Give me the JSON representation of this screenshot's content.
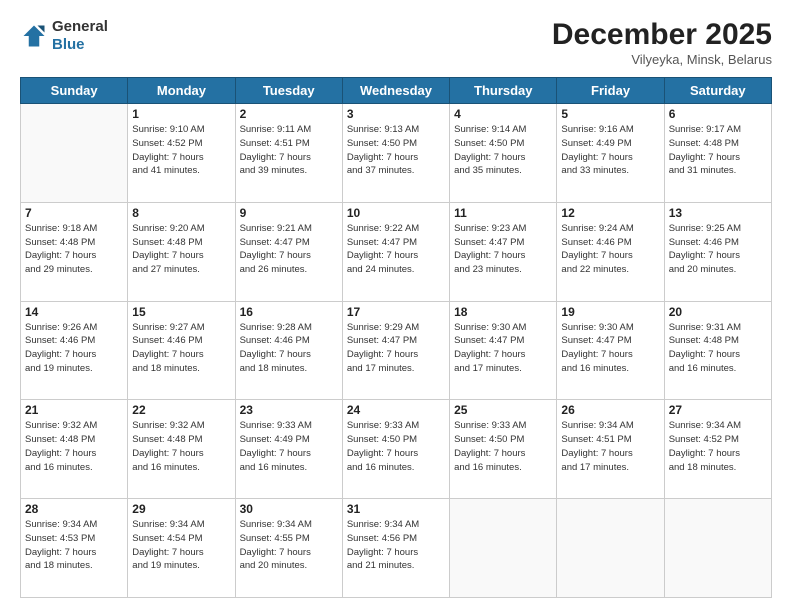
{
  "header": {
    "logo_line1": "General",
    "logo_line2": "Blue",
    "month": "December 2025",
    "location": "Vilyeyka, Minsk, Belarus"
  },
  "days_of_week": [
    "Sunday",
    "Monday",
    "Tuesday",
    "Wednesday",
    "Thursday",
    "Friday",
    "Saturday"
  ],
  "weeks": [
    [
      {
        "day": "",
        "info": ""
      },
      {
        "day": "1",
        "info": "Sunrise: 9:10 AM\nSunset: 4:52 PM\nDaylight: 7 hours\nand 41 minutes."
      },
      {
        "day": "2",
        "info": "Sunrise: 9:11 AM\nSunset: 4:51 PM\nDaylight: 7 hours\nand 39 minutes."
      },
      {
        "day": "3",
        "info": "Sunrise: 9:13 AM\nSunset: 4:50 PM\nDaylight: 7 hours\nand 37 minutes."
      },
      {
        "day": "4",
        "info": "Sunrise: 9:14 AM\nSunset: 4:50 PM\nDaylight: 7 hours\nand 35 minutes."
      },
      {
        "day": "5",
        "info": "Sunrise: 9:16 AM\nSunset: 4:49 PM\nDaylight: 7 hours\nand 33 minutes."
      },
      {
        "day": "6",
        "info": "Sunrise: 9:17 AM\nSunset: 4:48 PM\nDaylight: 7 hours\nand 31 minutes."
      }
    ],
    [
      {
        "day": "7",
        "info": "Sunrise: 9:18 AM\nSunset: 4:48 PM\nDaylight: 7 hours\nand 29 minutes."
      },
      {
        "day": "8",
        "info": "Sunrise: 9:20 AM\nSunset: 4:48 PM\nDaylight: 7 hours\nand 27 minutes."
      },
      {
        "day": "9",
        "info": "Sunrise: 9:21 AM\nSunset: 4:47 PM\nDaylight: 7 hours\nand 26 minutes."
      },
      {
        "day": "10",
        "info": "Sunrise: 9:22 AM\nSunset: 4:47 PM\nDaylight: 7 hours\nand 24 minutes."
      },
      {
        "day": "11",
        "info": "Sunrise: 9:23 AM\nSunset: 4:47 PM\nDaylight: 7 hours\nand 23 minutes."
      },
      {
        "day": "12",
        "info": "Sunrise: 9:24 AM\nSunset: 4:46 PM\nDaylight: 7 hours\nand 22 minutes."
      },
      {
        "day": "13",
        "info": "Sunrise: 9:25 AM\nSunset: 4:46 PM\nDaylight: 7 hours\nand 20 minutes."
      }
    ],
    [
      {
        "day": "14",
        "info": "Sunrise: 9:26 AM\nSunset: 4:46 PM\nDaylight: 7 hours\nand 19 minutes."
      },
      {
        "day": "15",
        "info": "Sunrise: 9:27 AM\nSunset: 4:46 PM\nDaylight: 7 hours\nand 18 minutes."
      },
      {
        "day": "16",
        "info": "Sunrise: 9:28 AM\nSunset: 4:46 PM\nDaylight: 7 hours\nand 18 minutes."
      },
      {
        "day": "17",
        "info": "Sunrise: 9:29 AM\nSunset: 4:47 PM\nDaylight: 7 hours\nand 17 minutes."
      },
      {
        "day": "18",
        "info": "Sunrise: 9:30 AM\nSunset: 4:47 PM\nDaylight: 7 hours\nand 17 minutes."
      },
      {
        "day": "19",
        "info": "Sunrise: 9:30 AM\nSunset: 4:47 PM\nDaylight: 7 hours\nand 16 minutes."
      },
      {
        "day": "20",
        "info": "Sunrise: 9:31 AM\nSunset: 4:48 PM\nDaylight: 7 hours\nand 16 minutes."
      }
    ],
    [
      {
        "day": "21",
        "info": "Sunrise: 9:32 AM\nSunset: 4:48 PM\nDaylight: 7 hours\nand 16 minutes."
      },
      {
        "day": "22",
        "info": "Sunrise: 9:32 AM\nSunset: 4:48 PM\nDaylight: 7 hours\nand 16 minutes."
      },
      {
        "day": "23",
        "info": "Sunrise: 9:33 AM\nSunset: 4:49 PM\nDaylight: 7 hours\nand 16 minutes."
      },
      {
        "day": "24",
        "info": "Sunrise: 9:33 AM\nSunset: 4:50 PM\nDaylight: 7 hours\nand 16 minutes."
      },
      {
        "day": "25",
        "info": "Sunrise: 9:33 AM\nSunset: 4:50 PM\nDaylight: 7 hours\nand 16 minutes."
      },
      {
        "day": "26",
        "info": "Sunrise: 9:34 AM\nSunset: 4:51 PM\nDaylight: 7 hours\nand 17 minutes."
      },
      {
        "day": "27",
        "info": "Sunrise: 9:34 AM\nSunset: 4:52 PM\nDaylight: 7 hours\nand 18 minutes."
      }
    ],
    [
      {
        "day": "28",
        "info": "Sunrise: 9:34 AM\nSunset: 4:53 PM\nDaylight: 7 hours\nand 18 minutes."
      },
      {
        "day": "29",
        "info": "Sunrise: 9:34 AM\nSunset: 4:54 PM\nDaylight: 7 hours\nand 19 minutes."
      },
      {
        "day": "30",
        "info": "Sunrise: 9:34 AM\nSunset: 4:55 PM\nDaylight: 7 hours\nand 20 minutes."
      },
      {
        "day": "31",
        "info": "Sunrise: 9:34 AM\nSunset: 4:56 PM\nDaylight: 7 hours\nand 21 minutes."
      },
      {
        "day": "",
        "info": ""
      },
      {
        "day": "",
        "info": ""
      },
      {
        "day": "",
        "info": ""
      }
    ]
  ]
}
